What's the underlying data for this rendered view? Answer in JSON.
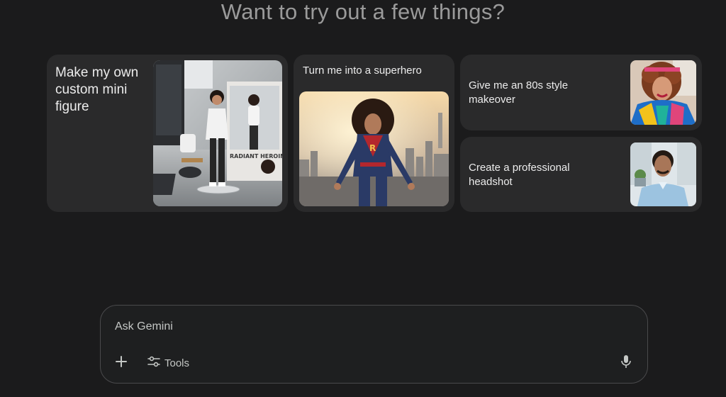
{
  "heading": "Want to try out a few things?",
  "cards": [
    {
      "label": "Make my own custom mini figure",
      "image_alt": "Mini figure of a woman next to a figure box on a desk",
      "box_text": "RADIANT HEROINE"
    },
    {
      "label": "Turn me into a superhero",
      "image_alt": "Woman in a superhero costume flying over a city",
      "emblem": "R"
    },
    {
      "label": "Give me an 80s style makeover",
      "image_alt": "Woman with 80s style curly hair and colorful outfit"
    },
    {
      "label": "Create a professional headshot",
      "image_alt": "Smiling man in a light blue shirt in an office"
    }
  ],
  "composer": {
    "placeholder": "Ask Gemini",
    "tools_label": "Tools",
    "icons": {
      "add": "plus-icon",
      "tools": "sliders-icon",
      "mic": "microphone-icon"
    }
  },
  "colors": {
    "background": "#1b1b1c",
    "card": "#2a2a2b",
    "heading": "#9a9a9a",
    "text": "#e3e3e3"
  }
}
